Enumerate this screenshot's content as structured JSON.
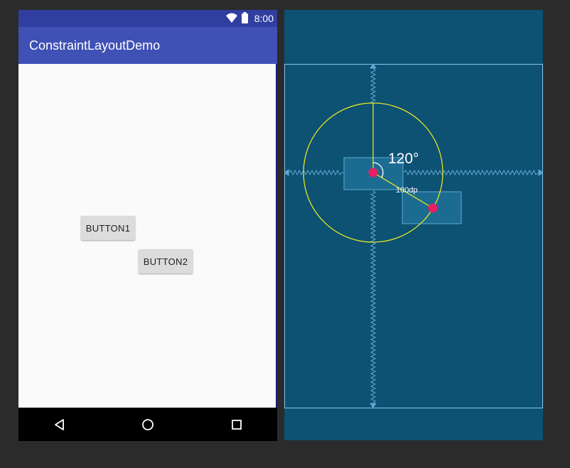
{
  "phone": {
    "status_bar": {
      "time": "8:00",
      "icons": [
        "wifi-icon",
        "battery-icon"
      ]
    },
    "app_bar": {
      "title": "ConstraintLayoutDemo"
    },
    "buttons": {
      "button1_label": "BUTTON1",
      "button2_label": "BUTTON2"
    },
    "nav_bar": {
      "icons": [
        "back-icon",
        "home-icon",
        "recents-icon"
      ]
    },
    "colors": {
      "status_bar": "#303f9f",
      "app_bar": "#3f51b5",
      "button": "#dcdcdc"
    }
  },
  "blueprint": {
    "circle_angle_label": "120°",
    "circle_radius_label": "100dp",
    "colors": {
      "background": "#0d5173",
      "circle": "#e6e621",
      "anchor_dot": "#e91e63",
      "outline": "#8ec5e8"
    }
  }
}
